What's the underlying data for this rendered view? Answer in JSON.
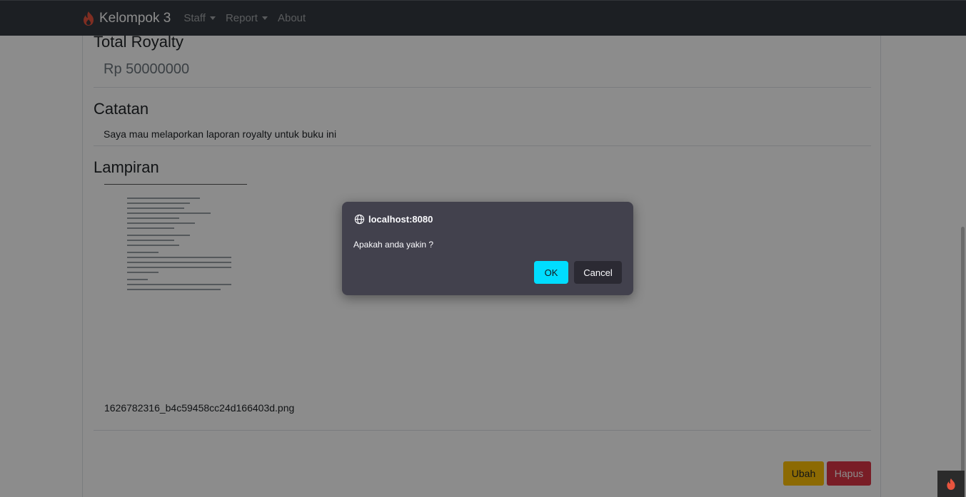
{
  "navbar": {
    "brand": "Kelompok 3",
    "items": [
      {
        "label": "Staff",
        "dropdown": true
      },
      {
        "label": "Report",
        "dropdown": true
      },
      {
        "label": "About",
        "dropdown": false
      }
    ]
  },
  "content": {
    "royalty_title": "Total Royalty",
    "royalty_value": "Rp 50000000",
    "catatan_title": "Catatan",
    "catatan_value": "Saya mau melaporkan laporan royalty untuk buku ini",
    "lampiran_title": "Lampiran",
    "attachment_filename": "1626782316_b4c59458cc24d166403d.png",
    "ubah_label": "Ubah",
    "hapus_label": "Hapus"
  },
  "dialog": {
    "host": "localhost:8080",
    "message": "Apakah anda yakin ?",
    "ok_label": "OK",
    "cancel_label": "Cancel"
  },
  "colors": {
    "navbar": "#343a40",
    "ubah": "#ffc107",
    "hapus": "#dc3545",
    "dialog_bg": "#42414d",
    "ok_button": "#00ddff",
    "brand_icon": "#e8543e"
  }
}
